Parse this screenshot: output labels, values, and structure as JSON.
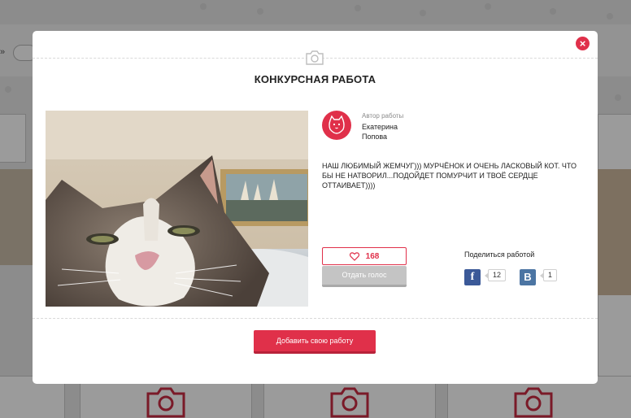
{
  "background": {
    "toggle_text": "»"
  },
  "modal": {
    "title": "КОНКУРСНАЯ РАБОТА",
    "close_glyph": "×",
    "author_caption": "Автор работы",
    "author_first_name": "Екатерина",
    "author_last_name": "Попова",
    "description": "НАШ ЛЮБИМЫЙ ЖЕМЧУГ))) МУРЧЁНОК И ОЧЕНЬ ЛАСКОВЫЙ КОТ. ЧТО БЫ НЕ НАТВОРИЛ...ПОДОЙДЕТ ПОМУРЧИТ И ТВОЁ СЕРДЦЕ ОТТАИВАЕТ))))",
    "likes_count": "168",
    "vote_label": "Отдать голос",
    "share_title": "Поделиться работой",
    "facebook_glyph": "f",
    "facebook_count": "12",
    "vk_glyph": "В",
    "vk_count": "1",
    "add_work_label": "Добавить свою работу"
  },
  "icons": {
    "close": "close-icon",
    "header": "camera-icon",
    "avatar": "cat-icon",
    "like": "heart-icon",
    "facebook": "facebook-icon",
    "vk": "vk-icon"
  },
  "colors": {
    "accent": "#e0304a",
    "facebook": "#3b5998",
    "vk": "#4c75a3",
    "vote_disabled": "#c4c4c4"
  }
}
